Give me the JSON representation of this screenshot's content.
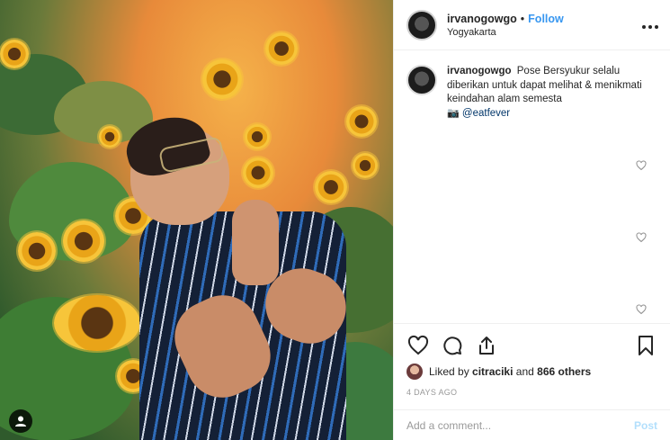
{
  "header": {
    "username": "irvanogowgo",
    "dot": "•",
    "follow_label": "Follow",
    "location": "Yogyakarta",
    "more_icon": "more-horizontal-icon"
  },
  "caption": {
    "username": "irvanogowgo",
    "text": "Pose Bersyukur selalu diberikan untuk dapat melihat & menikmati keindahan alam semesta",
    "camera_emoji": "📷",
    "mention": "@eatfever"
  },
  "actions": {
    "like_icon": "heart-icon",
    "comment_icon": "comment-icon",
    "share_icon": "share-icon",
    "save_icon": "bookmark-icon"
  },
  "likes": {
    "prefix": "Liked by",
    "user": "citraciki",
    "and": "and",
    "others": "866 others"
  },
  "timestamp": "4 DAYS AGO",
  "comment_box": {
    "placeholder": "Add a comment...",
    "post_label": "Post"
  },
  "colors": {
    "accent": "#3897f0",
    "post_disabled": "#b2dffc",
    "muted": "#999999"
  }
}
